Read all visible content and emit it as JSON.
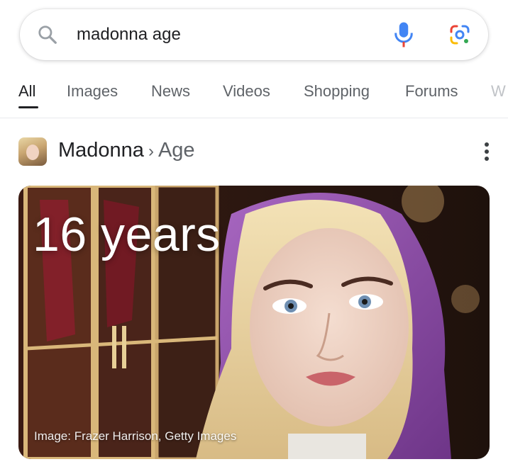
{
  "search": {
    "query": "madonna age"
  },
  "tabs": [
    {
      "label": "All",
      "active": true
    },
    {
      "label": "Images"
    },
    {
      "label": "News"
    },
    {
      "label": "Videos"
    },
    {
      "label": "Shopping"
    },
    {
      "label": "Forums"
    },
    {
      "label": "W"
    }
  ],
  "result": {
    "entity": "Madonna",
    "separator": "›",
    "attribute": "Age",
    "answer": "16 years",
    "image_credit": "Image: Frazer Harrison, Getty Images"
  },
  "colors": {
    "mic_blue": "#4285F4",
    "mic_red": "#EA4335",
    "lens_blue": "#4285F4",
    "lens_red": "#EA4335",
    "lens_yellow": "#FBBC05",
    "lens_green": "#34A853",
    "hood_purple": "#8e4aa8"
  }
}
